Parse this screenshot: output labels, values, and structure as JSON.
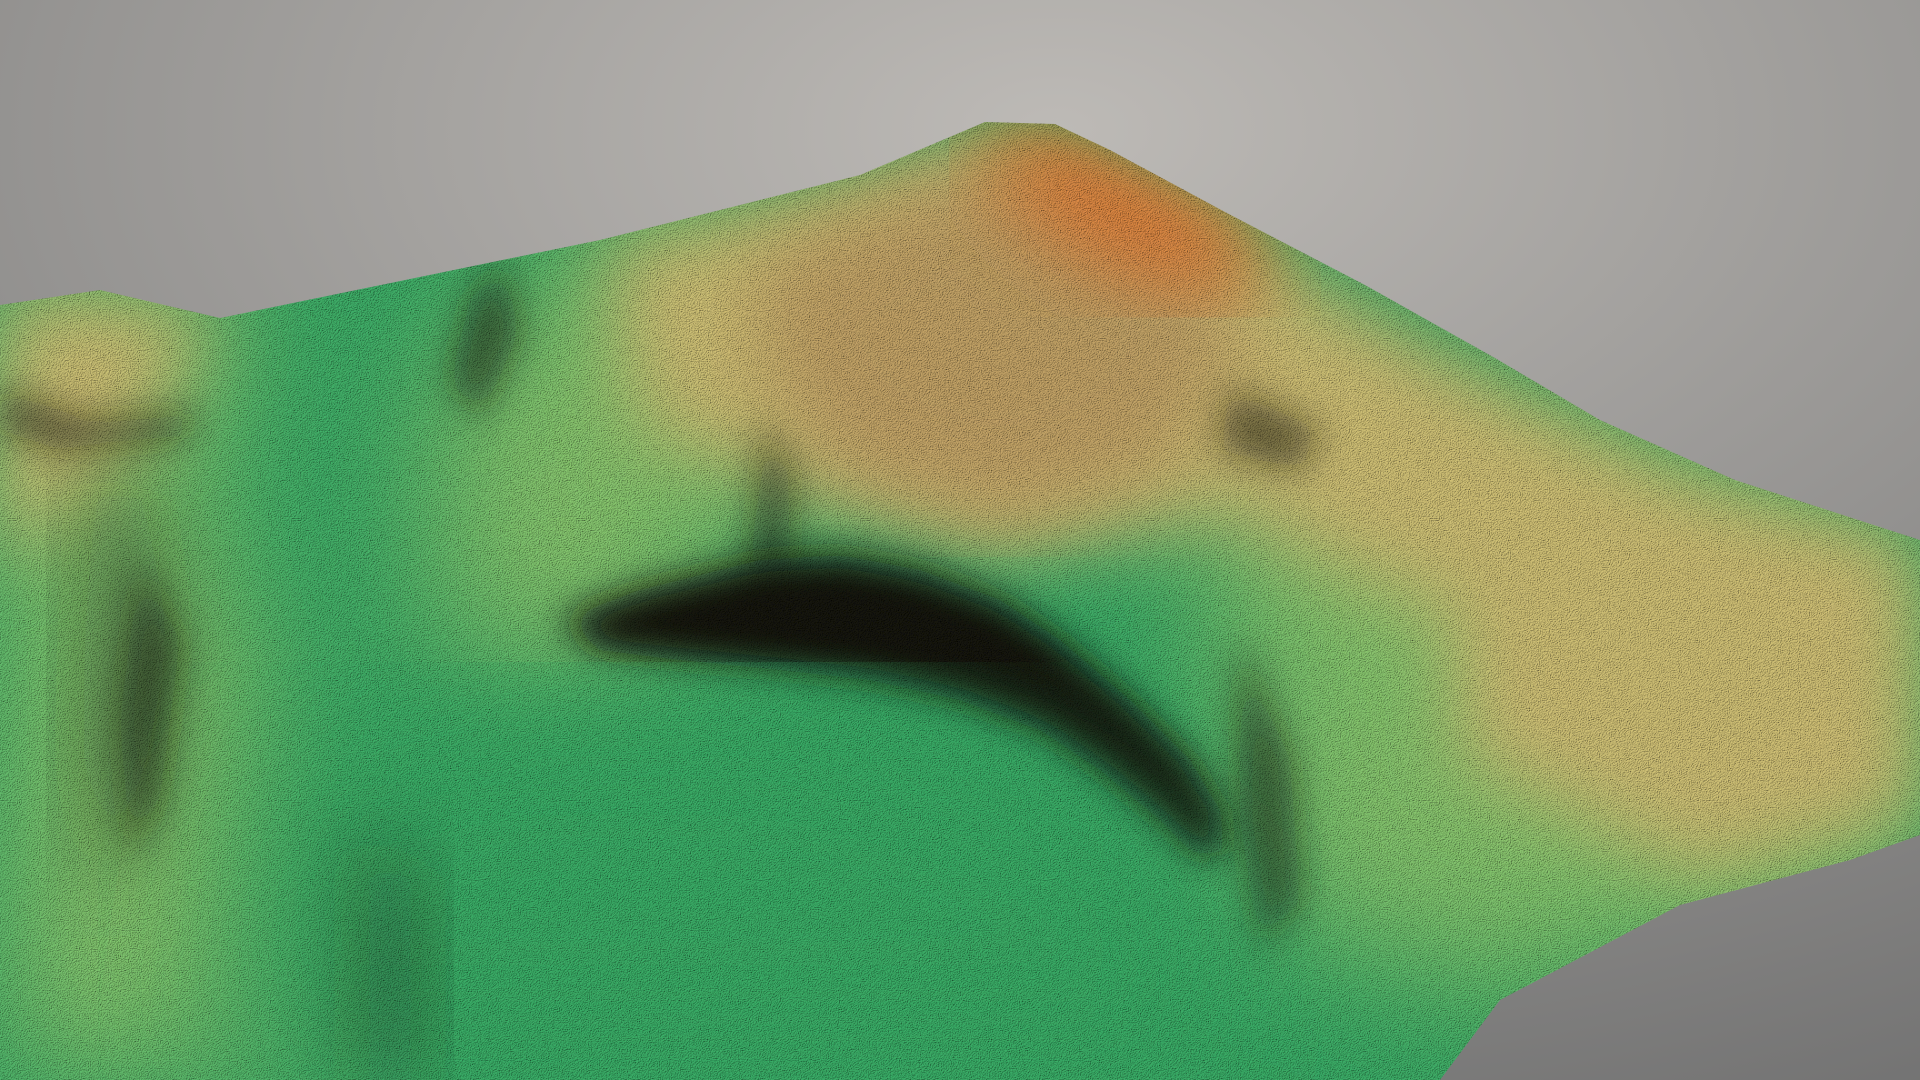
{
  "scene": {
    "subject": "terrain-model",
    "colors": {
      "background_light": "#bdbab6",
      "background_dark": "#6f6f6f",
      "lowland_green": "#3cb26b",
      "midland_green": "#8ccc72",
      "upland_yellow": "#d6c679",
      "slope_tan": "#c9a86a",
      "peak_orange": "#e7843e",
      "shadow": "#151510"
    }
  }
}
